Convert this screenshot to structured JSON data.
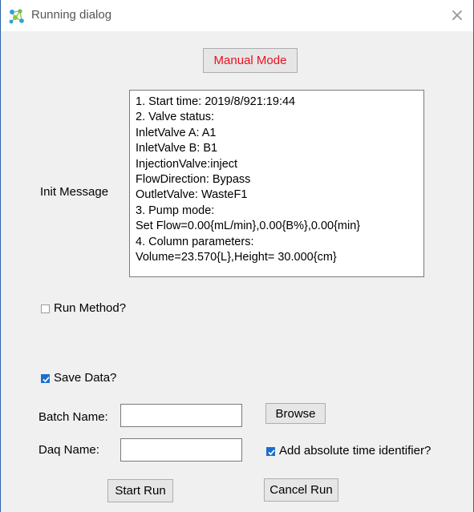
{
  "window": {
    "title": "Running dialog",
    "close_glyph": "×"
  },
  "icons": {
    "app": "network-nodes-icon",
    "close": "close-icon",
    "check": "checkmark-icon"
  },
  "colors": {
    "manual_mode_text": "#e8101f",
    "window_border": "#2b63b0",
    "checkbox_checked": "#1b6ed0"
  },
  "mode_button": {
    "label": "Manual Mode"
  },
  "init_message": {
    "label": "Init Message",
    "lines": [
      "1. Start time: 2019/8/921:19:44",
      "2. Valve status:",
      "InletValve A: A1",
      "InletValve B: B1",
      "InjectionValve:inject",
      "FlowDirection: Bypass",
      "OutletValve: WasteF1",
      "3. Pump mode:",
      "Set Flow=0.00{mL/min},0.00{B%},0.00{min}",
      "4. Column parameters:",
      "Volume=23.570{L},Height= 30.000{cm}"
    ]
  },
  "run_method": {
    "label": "Run Method?",
    "checked": false
  },
  "save_data": {
    "label": "Save Data?",
    "checked": true
  },
  "batch_name": {
    "label": "Batch Name:",
    "value": ""
  },
  "browse_button": {
    "label": "Browse"
  },
  "daq_name": {
    "label": "Daq Name:",
    "value": ""
  },
  "absolute_time": {
    "label": "Add absolute time identifier?",
    "checked": true
  },
  "start_button": {
    "label": "Start Run"
  },
  "cancel_button": {
    "label": "Cancel Run"
  }
}
